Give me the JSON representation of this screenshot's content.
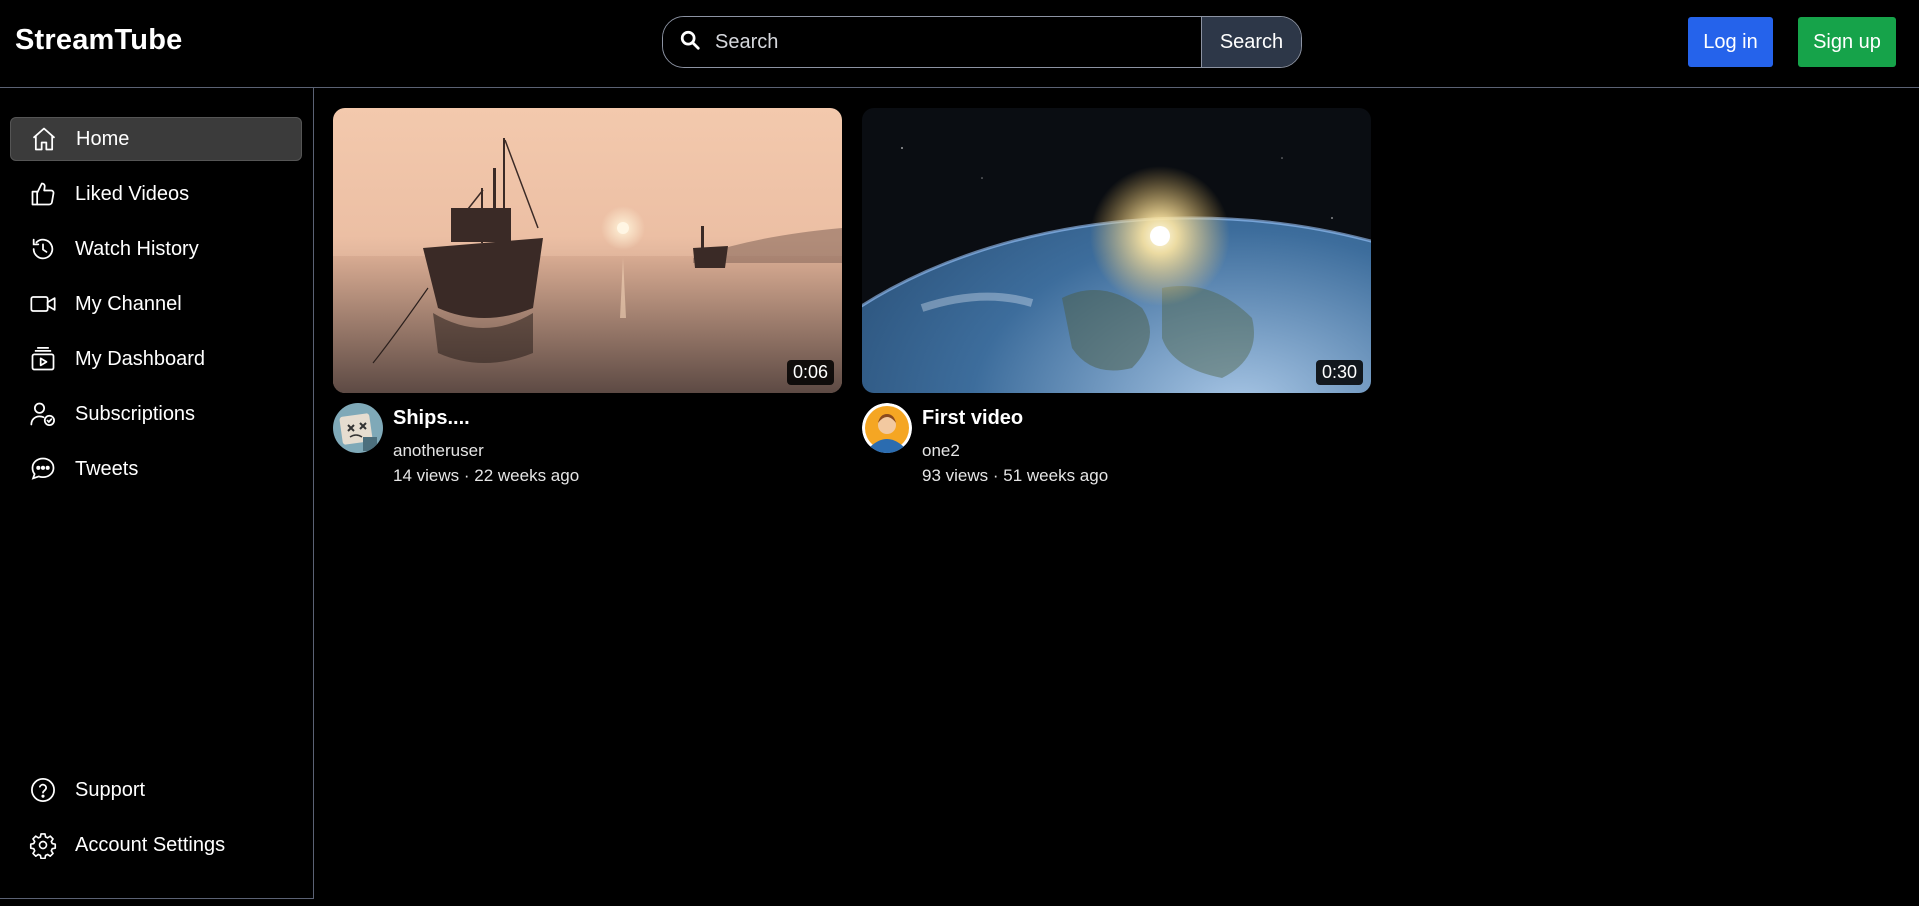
{
  "header": {
    "logo": "StreamTube",
    "search_placeholder": "Search",
    "search_button": "Search",
    "login": "Log in",
    "signup": "Sign up"
  },
  "sidebar": {
    "items": [
      {
        "label": "Home",
        "icon": "home-icon",
        "active": true
      },
      {
        "label": "Liked Videos",
        "icon": "thumbs-up-icon"
      },
      {
        "label": "Watch History",
        "icon": "history-icon"
      },
      {
        "label": "My Channel",
        "icon": "video-camera-icon"
      },
      {
        "label": "My Dashboard",
        "icon": "dashboard-icon"
      },
      {
        "label": "Subscriptions",
        "icon": "subscriptions-icon"
      },
      {
        "label": "Tweets",
        "icon": "chat-icon"
      }
    ],
    "bottom": [
      {
        "label": "Support",
        "icon": "help-icon"
      },
      {
        "label": "Account Settings",
        "icon": "gear-icon"
      }
    ]
  },
  "videos": [
    {
      "title": "Ships....",
      "channel": "anotheruser",
      "views": "14 views",
      "age": "22 weeks ago",
      "meta": "14 views · 22 weeks ago",
      "duration": "0:06"
    },
    {
      "title": "First video",
      "channel": "one2",
      "views": "93 views",
      "age": "51 weeks ago",
      "meta": "93 views · 51 weeks ago",
      "duration": "0:30"
    }
  ],
  "colors": {
    "login": "#2563eb",
    "signup": "#16a34a",
    "search_button": "#2d3748"
  }
}
